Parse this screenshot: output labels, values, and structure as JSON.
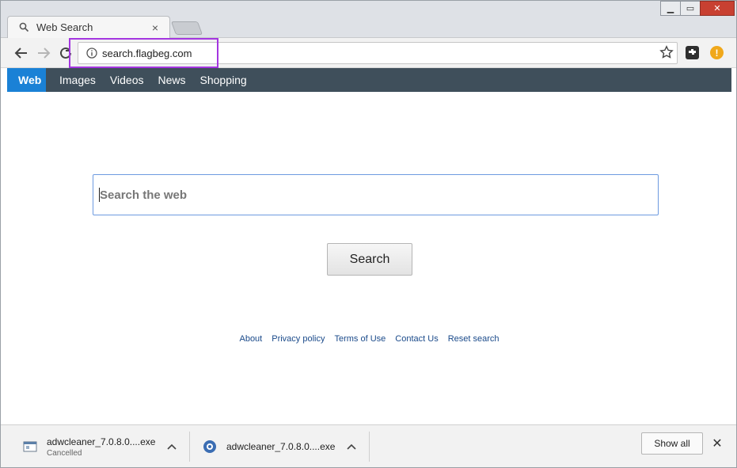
{
  "tab": {
    "title": "Web Search",
    "close_glyph": "×"
  },
  "window_controls": {
    "minimize": "▁",
    "maximize": "▭",
    "close": "✕"
  },
  "address_bar": {
    "url": "search.flagbeg.com"
  },
  "nav": {
    "items": [
      {
        "label": "Web",
        "active": true
      },
      {
        "label": "Images"
      },
      {
        "label": "Videos"
      },
      {
        "label": "News"
      },
      {
        "label": "Shopping"
      }
    ]
  },
  "search": {
    "placeholder": "Search the web",
    "button_label": "Search"
  },
  "footer": {
    "links": [
      "About",
      "Privacy policy",
      "Terms of Use",
      "Contact Us",
      "Reset search"
    ]
  },
  "downloads": {
    "items": [
      {
        "name": "adwcleaner_7.0.8.0....exe",
        "status": "Cancelled"
      },
      {
        "name": "adwcleaner_7.0.8.0....exe",
        "status": ""
      }
    ],
    "show_all_label": "Show all",
    "close_glyph": "✕"
  },
  "colors": {
    "accent": "#1a81d6",
    "navbar": "#3f4f5b",
    "highlight": "#a436e0",
    "alert": "#f0a81b"
  }
}
